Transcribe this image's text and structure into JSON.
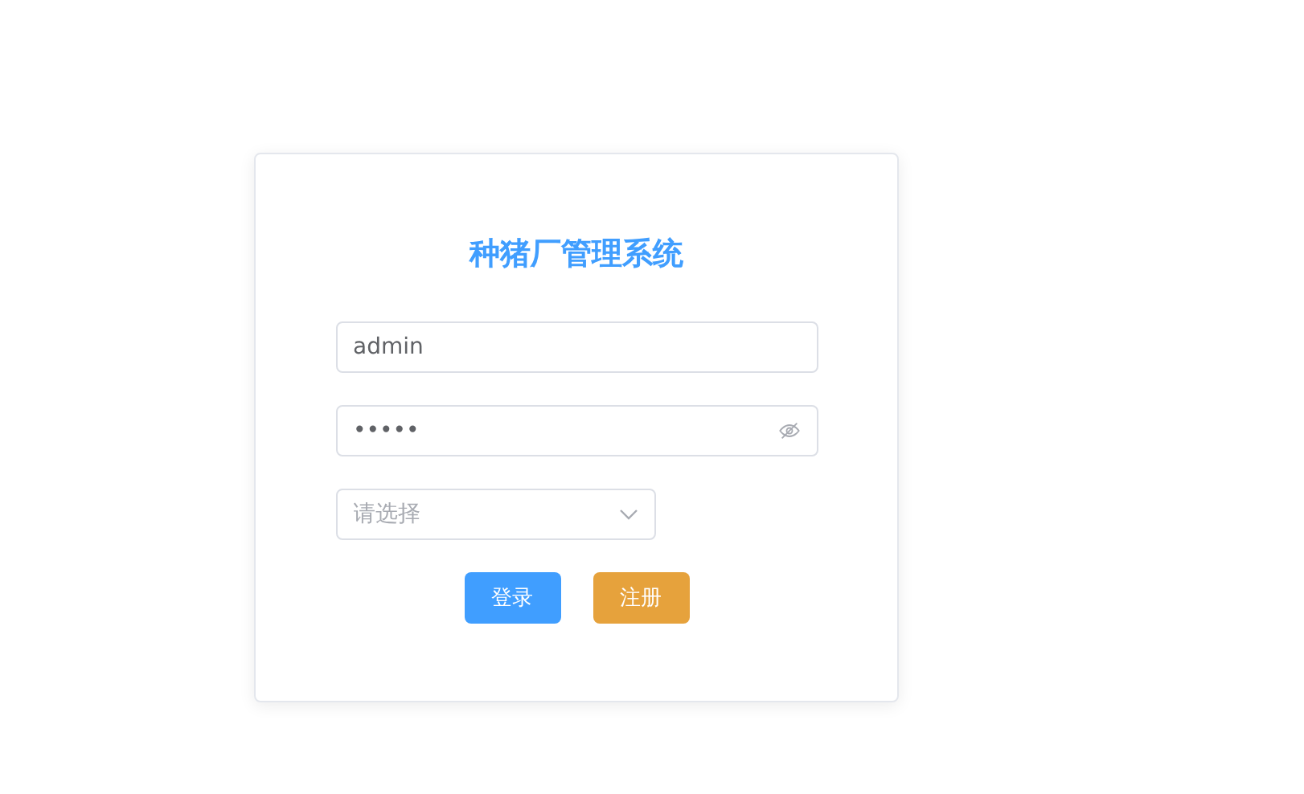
{
  "title": "种猪厂管理系统",
  "username": {
    "value": "admin"
  },
  "password": {
    "value": "•••••"
  },
  "role_select": {
    "placeholder": "请选择"
  },
  "buttons": [
    {
      "label": "登录",
      "kind": "primary"
    },
    {
      "label": "注册",
      "kind": "warning"
    }
  ]
}
